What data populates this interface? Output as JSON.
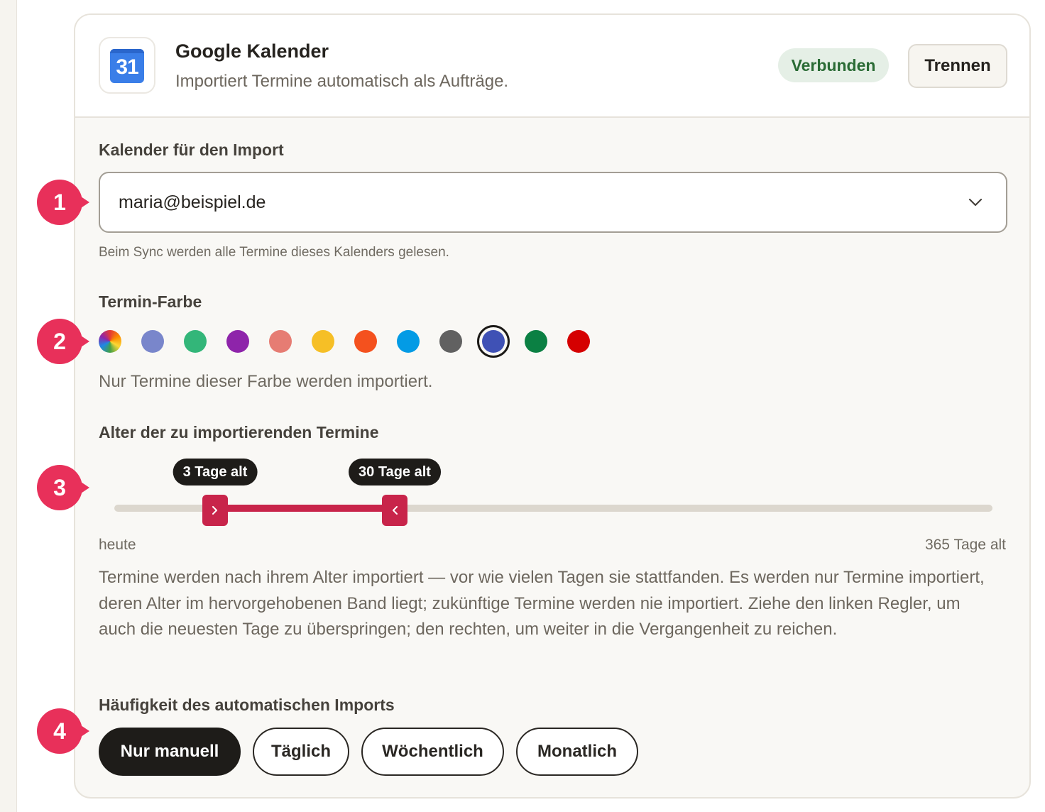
{
  "integration": {
    "name": "Google Kalender",
    "description": "Importiert Termine automatisch als Aufträge.",
    "icon_text": "31",
    "status": "Verbunden",
    "disconnect_label": "Trennen"
  },
  "calendar_select": {
    "label": "Kalender für den Import",
    "value": "maria@beispiel.de",
    "hint": "Beim Sync werden alle Termine dieses Kalenders gelesen."
  },
  "color": {
    "label": "Termin-Farbe",
    "hint": "Nur Termine dieser Farbe werden importiert.",
    "swatches": [
      {
        "name": "all-colors",
        "color": "conic"
      },
      {
        "name": "lavender",
        "color": "#7986cb"
      },
      {
        "name": "sage",
        "color": "#33b679"
      },
      {
        "name": "grape",
        "color": "#8e24aa"
      },
      {
        "name": "flamingo",
        "color": "#e67c73"
      },
      {
        "name": "banana",
        "color": "#f6bf26"
      },
      {
        "name": "tangerine",
        "color": "#f4511e"
      },
      {
        "name": "peacock",
        "color": "#039be5"
      },
      {
        "name": "graphite",
        "color": "#616161"
      },
      {
        "name": "blueberry",
        "color": "#3f51b5"
      },
      {
        "name": "basil",
        "color": "#0b8043"
      },
      {
        "name": "tomato",
        "color": "#d50000"
      }
    ],
    "selected_index": 9
  },
  "age": {
    "label": "Alter der zu importierenden Termine",
    "min_days": 3,
    "max_days": 30,
    "range_max": 365,
    "min_label": "3 Tage alt",
    "max_label": "30 Tage alt",
    "scale_start": "heute",
    "scale_end": "365 Tage alt",
    "description": "Termine werden nach ihrem Alter importiert — vor wie vielen Tagen sie stattfanden. Es werden nur Termine importiert, deren Alter im hervorgehobenen Band liegt; zukünftige Termine werden nie importiert. Ziehe den linken Regler, um auch die neuesten Tage zu überspringen; den rechten, um weiter in die Vergangenheit zu reichen."
  },
  "frequency": {
    "label": "Häufigkeit des automatischen Imports",
    "options": [
      "Nur manuell",
      "Täglich",
      "Wöchentlich",
      "Monatlich"
    ],
    "selected_index": 0
  },
  "markers": [
    "1",
    "2",
    "3",
    "4"
  ],
  "colors": {
    "accent": "#c8244a",
    "marker": "#e8305a",
    "badge_bg": "#e5efe6",
    "badge_text": "#2a6b35"
  }
}
